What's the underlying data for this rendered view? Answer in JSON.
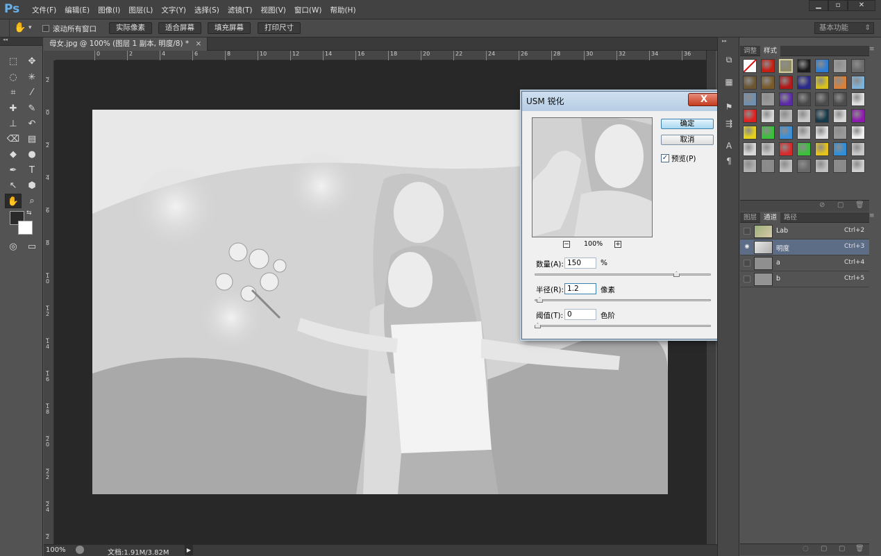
{
  "app": {
    "logo": "Ps"
  },
  "menu": [
    "文件(F)",
    "编辑(E)",
    "图像(I)",
    "图层(L)",
    "文字(Y)",
    "选择(S)",
    "滤镜(T)",
    "视图(V)",
    "窗口(W)",
    "帮助(H)"
  ],
  "window_controls": {
    "minimize": "▁",
    "restore": "▫",
    "close": "✕"
  },
  "options": {
    "scroll_all_label": "滚动所有窗口",
    "buttons": [
      "实际像素",
      "适合屏幕",
      "填充屏幕",
      "打印尺寸"
    ],
    "workspace": "基本功能",
    "workspace_caret": "⇕"
  },
  "document": {
    "tab_title": "母女.jpg @ 100% (图层 1 副本, 明度/8) *",
    "tab_close": "×",
    "ruler_h": [
      "0",
      "2",
      "4",
      "6",
      "8",
      "10",
      "12",
      "14",
      "16",
      "18",
      "20",
      "22",
      "24",
      "26",
      "28",
      "30",
      "32",
      "34",
      "36"
    ],
    "ruler_v": [
      "2",
      "0",
      "2",
      "4",
      "6",
      "8",
      "1\n0",
      "1\n2",
      "1\n4",
      "1\n6",
      "1\n8",
      "2\n0",
      "2\n2",
      "2\n4",
      "2"
    ]
  },
  "status": {
    "zoom": "100%",
    "doc_info": "文档:1.91M/3.82M",
    "arrow": "▶"
  },
  "dialog": {
    "title": "USM 锐化",
    "close": "X",
    "ok": "确定",
    "cancel": "取消",
    "preview_label": "预览(P)",
    "preview_checked": true,
    "check_mark": "✓",
    "zoom_minus": "−",
    "zoom_plus": "+",
    "zoom_level": "100%",
    "amount": {
      "label": "数量(A):",
      "value": "150",
      "unit": "%",
      "level_fraction": 0.34
    },
    "radius": {
      "label": "半径(R):",
      "value": "1.2",
      "unit": "像素",
      "level_fraction": 0.005
    },
    "threshold": {
      "label": "阈值(T):",
      "value": "0",
      "unit": "色阶",
      "level_fraction": 0.0
    }
  },
  "styles_panel": {
    "tabs": [
      "调整",
      "样式"
    ],
    "active_tab": "样式",
    "swatches": [
      "#ffffff",
      "#c81e12",
      "#8e8a6a",
      "#1c1c1c",
      "#2f7dd3",
      "#9c9c9c",
      "#6a6a6a",
      "#6b5532",
      "#7a5a2a",
      "#b21818",
      "#2a2a8a",
      "#d6c21a",
      "#d9813a",
      "#7fb3d8",
      "#6f8fae",
      "#9a9a9a",
      "#5a2aa8",
      "#4a4a4a",
      "#4b4b4b",
      "#4c4c4c",
      "#e0e0e0",
      "#e12121",
      "#d8d8d8",
      "#b9b9b9",
      "#c8c8c8",
      "#163a4a",
      "#d8d8d8",
      "#8e1ab0",
      "#e4d21c",
      "#3ac03a",
      "#3a8fd8",
      "#c8c8c8",
      "#e0e0e0",
      "#9a9a9a",
      "#f0f0f0",
      "#d8d8d8",
      "#c8c8c8",
      "#d82a2a",
      "#3ac03a",
      "#e6c21a",
      "#2f8fd8",
      "#c8c8c8",
      "#b0b0b0",
      "#8a8a8a",
      "#bdbdbd",
      "#6a6a6a",
      "#c0c0c0",
      "#8a8a8a",
      "#cfcfcf"
    ]
  },
  "channels_panel": {
    "tabs": [
      "图层",
      "通道",
      "路径"
    ],
    "active_tab": "通道",
    "eye": "◉",
    "channels": [
      {
        "name": "Lab",
        "shortcut": "Ctrl+2",
        "visible": false
      },
      {
        "name": "明度",
        "shortcut": "Ctrl+3",
        "visible": true
      },
      {
        "name": "a",
        "shortcut": "Ctrl+4",
        "visible": false
      },
      {
        "name": "b",
        "shortcut": "Ctrl+5",
        "visible": false
      }
    ]
  },
  "icons": {
    "hand": "✋",
    "caret": "▾",
    "collapse": "◂◂",
    "expand": "▸▸",
    "marquee": "⬚",
    "move": "✥",
    "lasso": "◌",
    "wand": "✳",
    "crop": "⌗",
    "eyedrop": "⁄",
    "heal": "✚",
    "brush": "✎",
    "stamp": "⊥",
    "history": "↶",
    "eraser": "⌫",
    "gradient": "▤",
    "blur": "◆",
    "dodge": "●",
    "pen": "✒",
    "type": "T",
    "select": "↖",
    "shape": "⬢",
    "zoom": "⌕",
    "rotate": "⟳",
    "swap": "⇆",
    "quickmask": "◎",
    "screenmode": "▭",
    "panel_menu": "≡",
    "trash": "🗑",
    "newitem": "▢",
    "forbid": "⊘",
    "circle": "◌"
  }
}
